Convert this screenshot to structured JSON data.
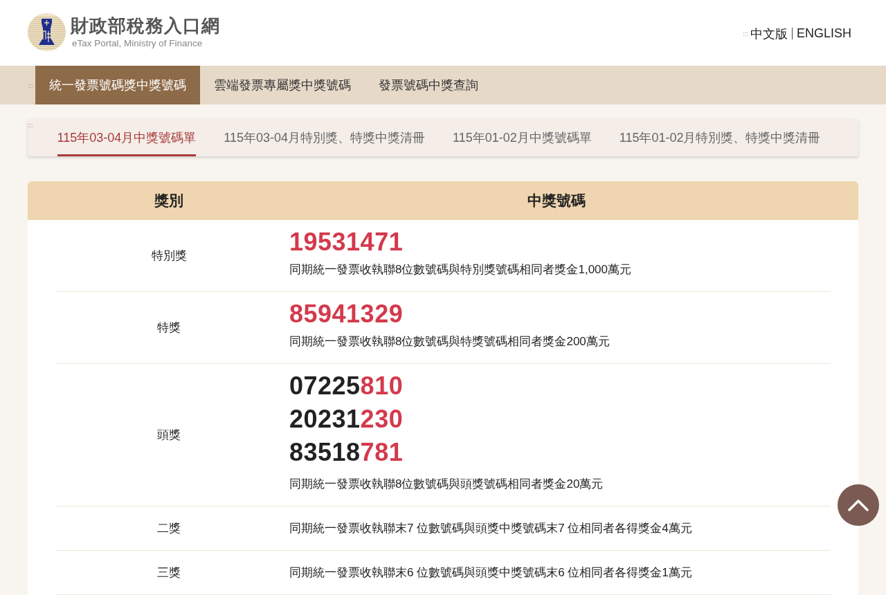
{
  "header": {
    "logo": {
      "title": "財政部稅務入口網",
      "subtitle": "eTax Portal, Ministry of Finance"
    },
    "accesskey": ":::",
    "languages": [
      {
        "label": "中文版"
      },
      {
        "label": "ENGLISH"
      }
    ]
  },
  "main_nav": {
    "accesskey": ":::",
    "items": [
      {
        "label": "統一發票號碼獎中獎號碼",
        "selected": true
      },
      {
        "label": "雲端發票專屬獎中獎號碼",
        "selected": false
      },
      {
        "label": "發票號碼中獎查詢",
        "selected": false
      }
    ]
  },
  "sub_tabs": {
    "accesskey": ":::",
    "items": [
      {
        "label": "115年03-04月中獎號碼單",
        "selected": true
      },
      {
        "label": "115年03-04月特別獎、特獎中獎清冊",
        "selected": false
      },
      {
        "label": "115年01-02月中獎號碼單",
        "selected": false
      },
      {
        "label": "115年01-02月特別獎、特獎中獎清冊",
        "selected": false
      }
    ]
  },
  "table": {
    "columns": [
      "獎別",
      "中獎號碼"
    ],
    "rows": [
      {
        "prize": "特別獎",
        "numbers": [
          {
            "segments": [
              {
                "text": "19531471",
                "highlighted": true
              }
            ]
          }
        ],
        "description": "同期統一發票收執聯8位數號碼與特別獎號碼相同者獎金1,000萬元"
      },
      {
        "prize": "特獎",
        "numbers": [
          {
            "segments": [
              {
                "text": "85941329",
                "highlighted": true
              }
            ]
          }
        ],
        "description": "同期統一發票收執聯8位數號碼與特獎號碼相同者獎金200萬元"
      },
      {
        "prize": "頭獎",
        "numbers": [
          {
            "segments": [
              {
                "text": "07225",
                "highlighted": false
              },
              {
                "text": "810",
                "highlighted": true
              }
            ]
          },
          {
            "segments": [
              {
                "text": "20231",
                "highlighted": false
              },
              {
                "text": "230",
                "highlighted": true
              }
            ]
          },
          {
            "segments": [
              {
                "text": "83518",
                "highlighted": false
              },
              {
                "text": "781",
                "highlighted": true
              }
            ]
          }
        ],
        "description": "同期統一發票收執聯8位數號碼與頭獎號碼相同者獎金20萬元"
      },
      {
        "prize": "二獎",
        "description": "同期統一發票收執聯末7 位數號碼與頭獎中獎號碼末7 位相同者各得獎金4萬元"
      },
      {
        "prize": "三獎",
        "description": "同期統一發票收執聯末6 位數號碼與頭獎中獎號碼末6 位相同者各得獎金1萬元"
      }
    ]
  }
}
